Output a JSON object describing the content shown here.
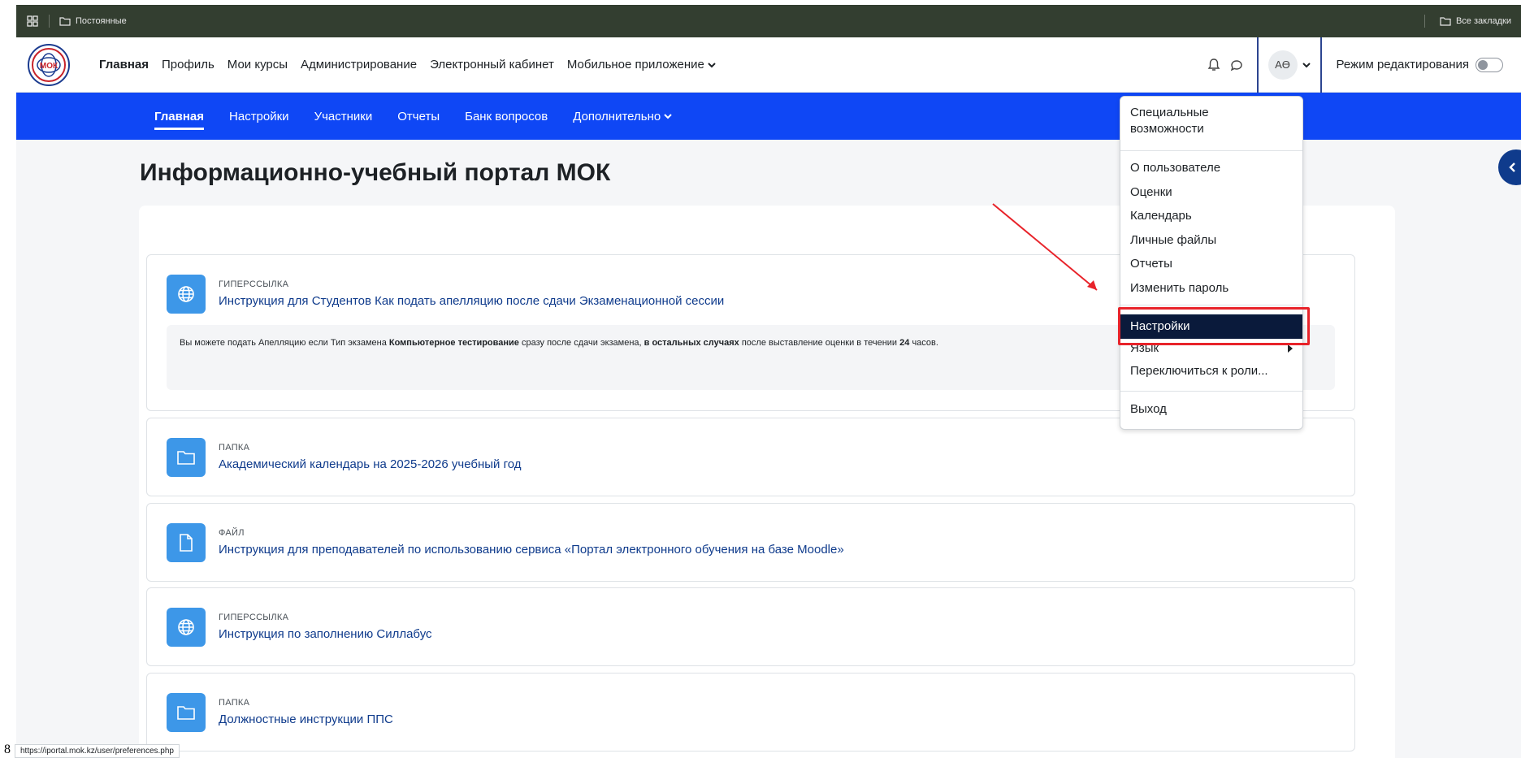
{
  "bookmarks": {
    "left_label": "Постоянные",
    "right_label": "Все закладки",
    "icons": [
      "apps-grid-icon",
      "folder-icon"
    ]
  },
  "navbar": {
    "logo_text": "МОК",
    "links": [
      "Главная",
      "Профиль",
      "Мои курсы",
      "Администрирование",
      "Электронный кабинет",
      "Мобильное приложение"
    ],
    "avatar_initials": "АӨ",
    "edit_mode_label": "Режим редактирования"
  },
  "secondary_nav": {
    "items": [
      "Главная",
      "Настройки",
      "Участники",
      "Отчеты",
      "Банк вопросов",
      "Дополнительно"
    ]
  },
  "page": {
    "title": "Информационно-учебный портал МОК"
  },
  "activities": [
    {
      "type": "ГИПЕРССЫЛКА",
      "name": "Инструкция для Студентов Как подать апелляцию после сдачи Экзаменационной сессии",
      "icon": "globe-icon",
      "description": {
        "t1": "Вы можете подать Апелляцию если Тип экзамена ",
        "b1": "Компьютерное тестирование",
        "t2": " сразу после сдачи экзамена, ",
        "b2": "в остальных случаях",
        "t3": " после выставление оценки в течении ",
        "b3": "24",
        "t4": " часов."
      }
    },
    {
      "type": "ПАПКА",
      "name": "Академический календарь на 2025-2026 учебный год",
      "icon": "folder-icon"
    },
    {
      "type": "ФАЙЛ",
      "name": "Инструкция для преподавателей по использованию сервиса «Портал электронного обучения на базе Moodle»",
      "icon": "file-icon"
    },
    {
      "type": "ГИПЕРССЫЛКА",
      "name": "Инструкция по заполнению Силлабус",
      "icon": "globe-icon"
    },
    {
      "type": "ПАПКА",
      "name": "Должностные инструкции ППС",
      "icon": "folder-icon"
    }
  ],
  "user_menu": {
    "accessibility": [
      "Специальные",
      "возможности"
    ],
    "items": [
      "О пользователе",
      "Оценки",
      "Календарь",
      "Личные файлы",
      "Отчеты",
      "Изменить пароль"
    ],
    "selected": "Настройки",
    "language": "Язык",
    "switch_role": "Переключиться к роли...",
    "logout": "Выход"
  },
  "status_bar": {
    "prefix": "8",
    "url": "https://iportal.mok.kz/user/preferences.php"
  },
  "colors": {
    "bookmark_bar": "#333e30",
    "secondary_nav": "#0f47f5",
    "activity_icon": "#3d97e8",
    "link": "#0f3b8c",
    "highlight": "#e8232a",
    "menu_selected": "#0a1a3b"
  }
}
